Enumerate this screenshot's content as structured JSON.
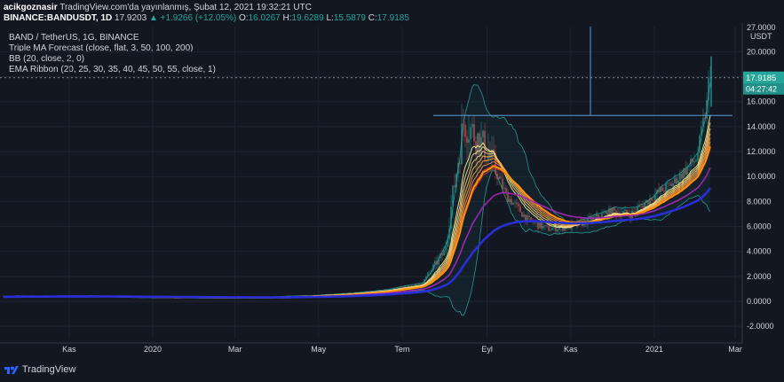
{
  "header": {
    "author": "acikgoznasir",
    "published": "TradingView.com'da yayınlanmış, Şubat 12, 2021 19:32:21 UTC",
    "symbol": "BINANCE:BANDUSDT, 1D",
    "last": "17.9203",
    "change": "▲ +1.9266 (+12.05%)",
    "o_label": "O:",
    "o_value": "16.0267",
    "h_label": "H:",
    "h_value": "19.6289",
    "l_label": "L:",
    "l_value": "15.5879",
    "c_label": "C:",
    "c_value": "17.9185"
  },
  "legend": [
    "BAND / TetherUS, 1G, BINANCE",
    "Triple MA Forecast (close, flat, 3, 50, 100, 200)",
    "BB (20, close, 2, 0)",
    "EMA Ribbon (20, 25, 30, 35, 40, 45, 50, 55, close, 1)"
  ],
  "price_tag": "17.9185",
  "countdown": "04:27:42",
  "currency": "USDT",
  "footer_brand": "TradingView",
  "colors": {
    "background": "#131722",
    "up": "#26a69a",
    "down": "#ef5350",
    "bb": "#26a69a",
    "ma50": "#ff9800",
    "ma100": "#9c27b0",
    "ma200": "#2a2ed6",
    "line": "#5b9bd5",
    "price_tag": "#26a69a"
  },
  "chart_data": {
    "type": "line",
    "title": "BAND / TetherUS, 1G, BINANCE",
    "ylim": [
      -2.5,
      22
    ],
    "y_ticks": [
      "-2.0000",
      "0.0000",
      "2.0000",
      "4.0000",
      "6.0000",
      "8.0000",
      "10.0000",
      "12.0000",
      "14.0000",
      "16.0000",
      "20.0000",
      "27.0000"
    ],
    "x_ticks": [
      "Kas",
      "2020",
      "Mar",
      "May",
      "Tem",
      "Eyl",
      "Kas",
      "2021",
      "Mar"
    ],
    "x": [
      "2019-11",
      "2019-12",
      "2020-01",
      "2020-02",
      "2020-03",
      "2020-04",
      "2020-05",
      "2020-06",
      "2020-07",
      "2020-08-01",
      "2020-08-15",
      "2020-09-01",
      "2020-09-15",
      "2020-10-01",
      "2020-10-15",
      "2020-11-01",
      "2020-11-15",
      "2020-12-01",
      "2020-12-15",
      "2021-01-01",
      "2021-01-15",
      "2021-02-01",
      "2021-02-12"
    ],
    "series": [
      {
        "name": "",
        "values": [
          0.4,
          0.35,
          0.3,
          0.28,
          0.3,
          0.4,
          0.55,
          0.85,
          1.4,
          4.0,
          14.5,
          12.0,
          8.5,
          6.5,
          5.8,
          6.0,
          6.5,
          7.2,
          7.0,
          8.5,
          9.5,
          11.5,
          17.92
        ]
      }
    ],
    "horizontal_level": 14.9,
    "grid": true,
    "legend_position": "top-left"
  }
}
